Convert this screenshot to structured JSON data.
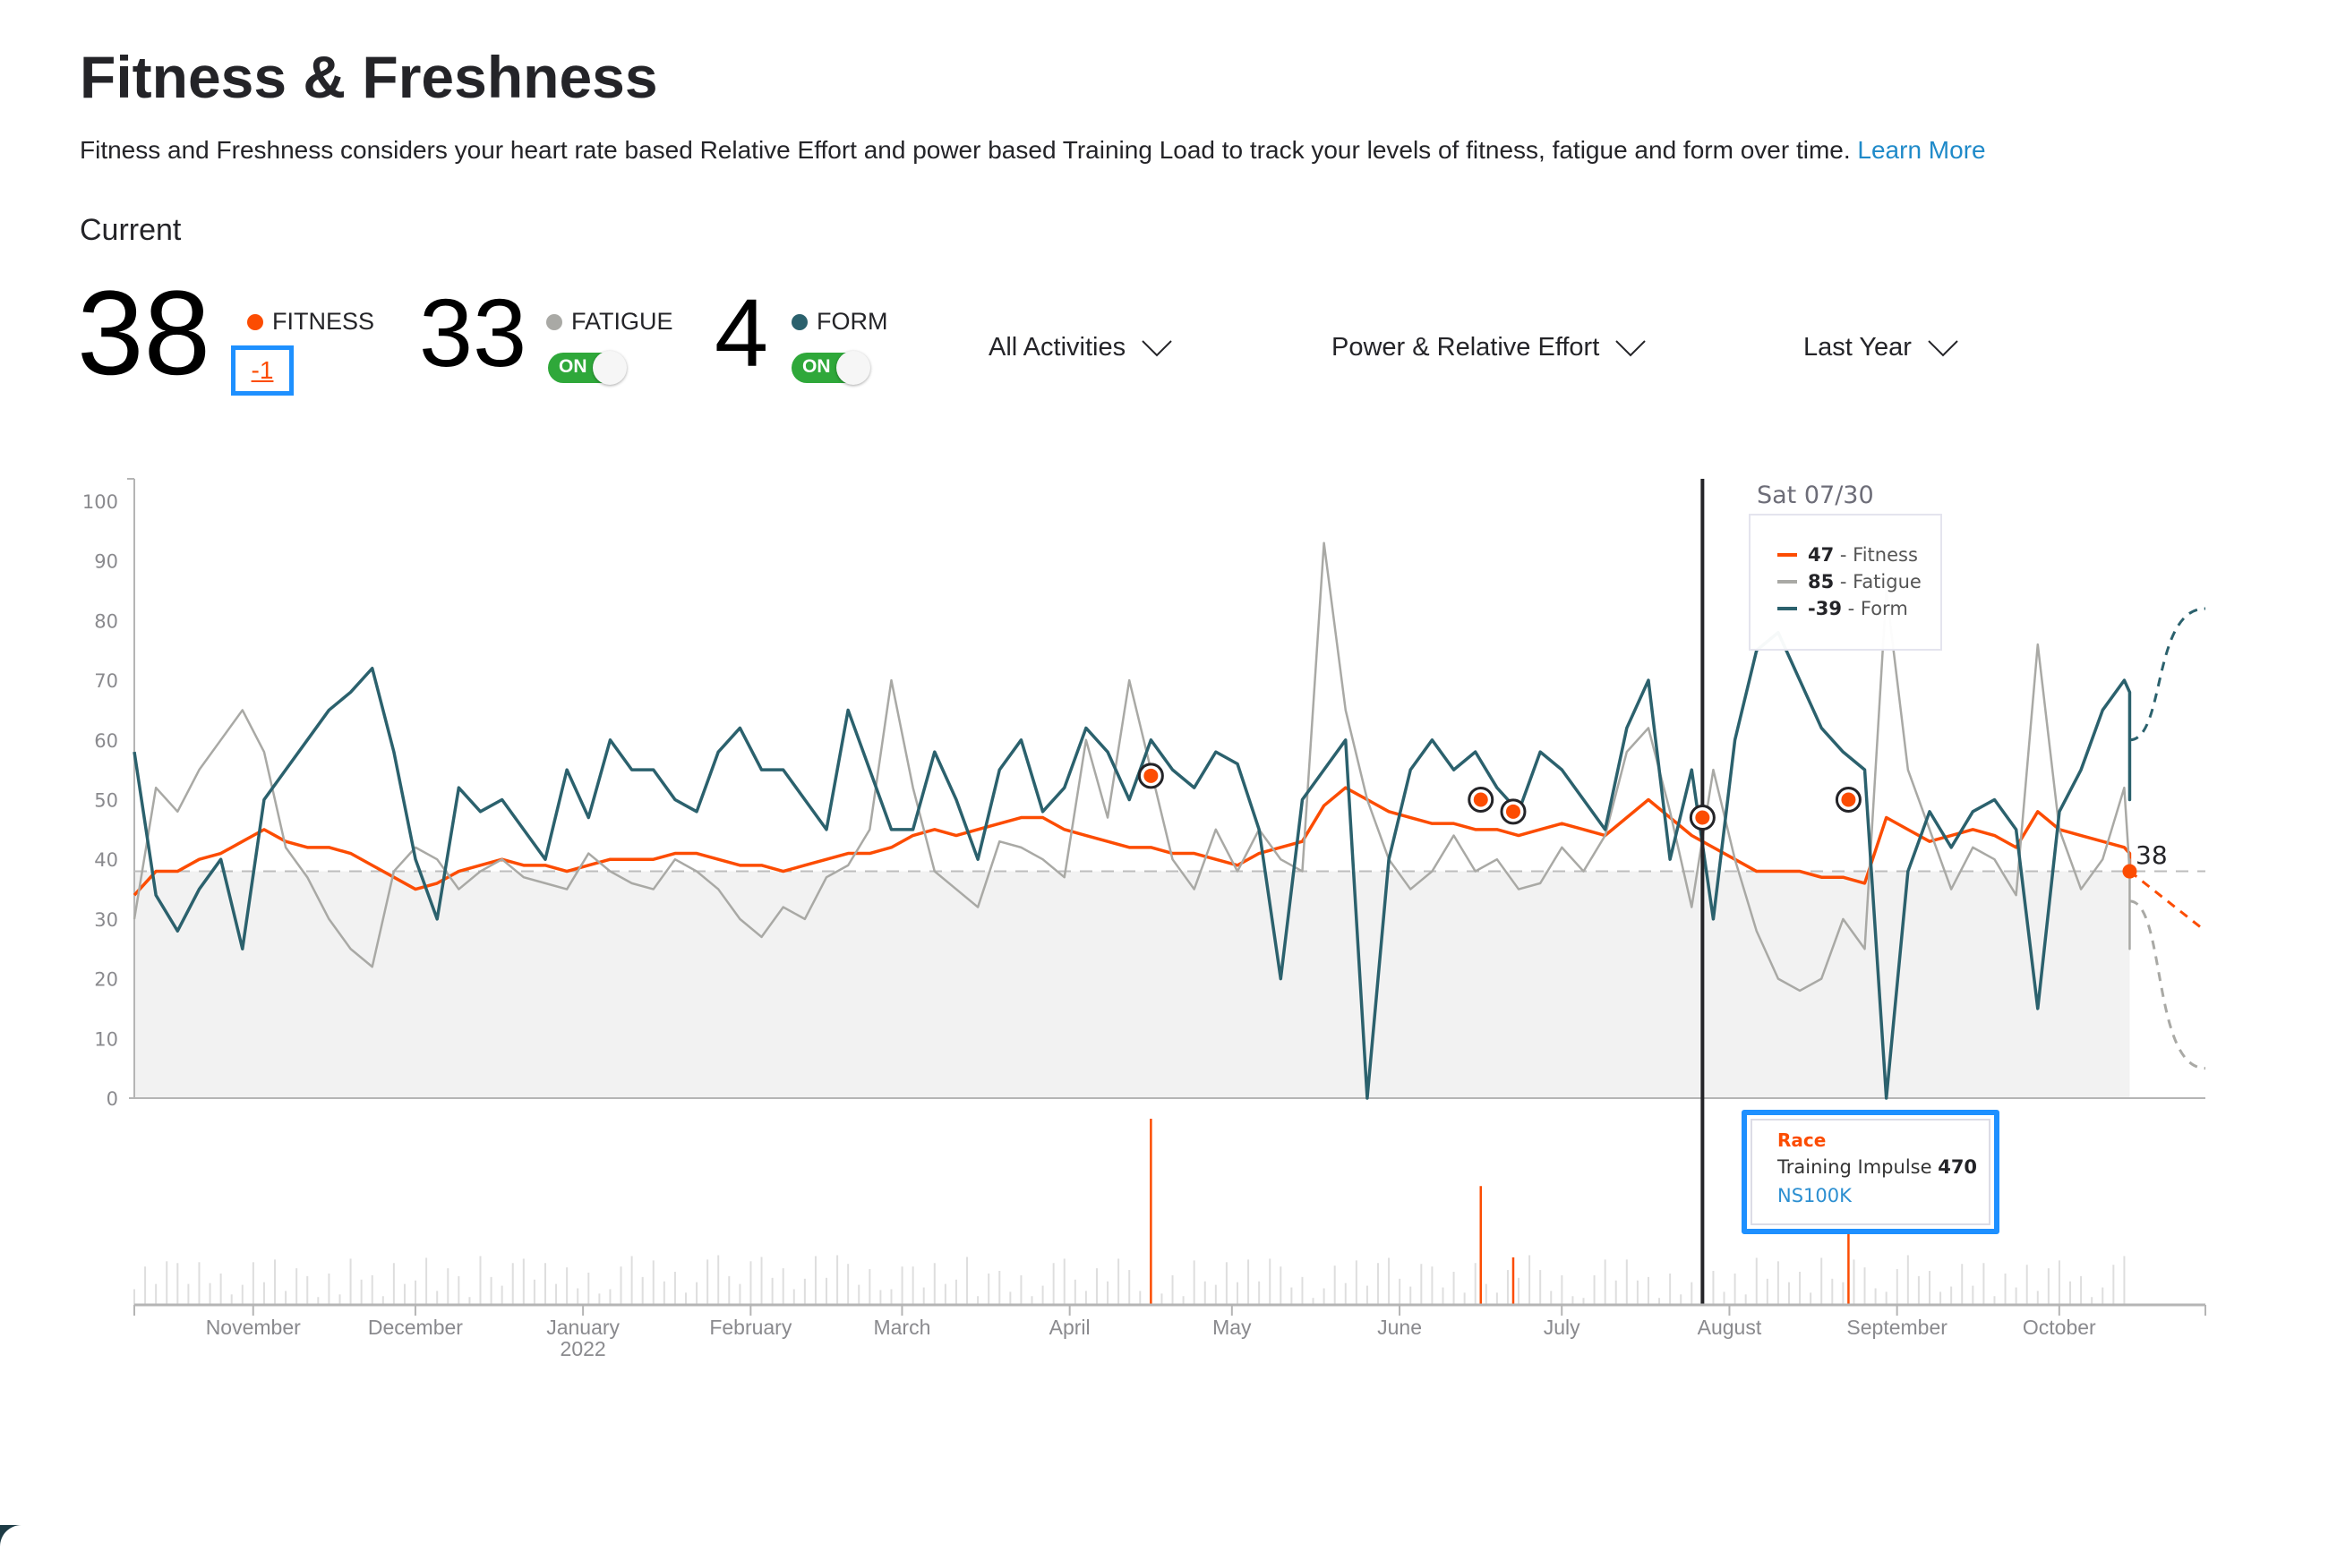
{
  "header": {
    "title": "Fitness & Freshness",
    "description": "Fitness and Freshness considers your heart rate based Relative Effort and power based Training Load to track your levels of fitness, fatigue and form over time.",
    "learn_more": "Learn More",
    "current_label": "Current"
  },
  "metrics": {
    "fitness": {
      "value": "38",
      "label": "FITNESS",
      "delta": "-1",
      "color": "#fc4c02"
    },
    "fatigue": {
      "value": "33",
      "label": "FATIGUE",
      "toggle": "ON",
      "toggle_on": true,
      "color": "#a9a9a5"
    },
    "form": {
      "value": "4",
      "label": "FORM",
      "toggle": "ON",
      "toggle_on": true,
      "color": "#2b616d"
    }
  },
  "filters": {
    "activities": "All Activities",
    "metric_type": "Power & Relative Effort",
    "range": "Last Year"
  },
  "tooltip": {
    "date": "Sat 07/30",
    "rows": [
      {
        "value": "47",
        "label": " - Fitness",
        "color": "#fc4c02"
      },
      {
        "value": "85",
        "label": " - Fatigue",
        "color": "#a9a9a5"
      },
      {
        "value": "-39",
        "label": " - Form",
        "color": "#2b616d"
      }
    ]
  },
  "race_tooltip": {
    "type": "Race",
    "metric_label": "Training Impulse ",
    "metric_value": "470",
    "activity_name": "NS100K"
  },
  "end_label": "38",
  "chart_data": {
    "type": "line",
    "title": "Fitness & Freshness",
    "xlabel": "",
    "ylabel": "",
    "ylim": [
      0,
      100
    ],
    "yticks": [
      0,
      10,
      20,
      30,
      40,
      50,
      60,
      70,
      80,
      90,
      100
    ],
    "x_start": "2021-10-13",
    "x_end": "2022-10-31",
    "today": "2022-10-17",
    "month_ticks": [
      {
        "date": "2021-11-01",
        "label": "November",
        "sub": ""
      },
      {
        "date": "2021-12-01",
        "label": "December",
        "sub": ""
      },
      {
        "date": "2022-01-01",
        "label": "January",
        "sub": "2022"
      },
      {
        "date": "2022-02-01",
        "label": "February",
        "sub": ""
      },
      {
        "date": "2022-03-01",
        "label": "March",
        "sub": ""
      },
      {
        "date": "2022-04-01",
        "label": "April",
        "sub": ""
      },
      {
        "date": "2022-05-01",
        "label": "May",
        "sub": ""
      },
      {
        "date": "2022-06-01",
        "label": "June",
        "sub": ""
      },
      {
        "date": "2022-07-01",
        "label": "July",
        "sub": ""
      },
      {
        "date": "2022-08-01",
        "label": "August",
        "sub": ""
      },
      {
        "date": "2022-09-01",
        "label": "September",
        "sub": ""
      },
      {
        "date": "2022-10-01",
        "label": "October",
        "sub": ""
      }
    ],
    "reference_line": 38,
    "step_days": 4,
    "series": [
      {
        "name": "Fitness",
        "color": "#fc4c02",
        "values": [
          34,
          38,
          38,
          40,
          41,
          43,
          45,
          43,
          42,
          42,
          41,
          39,
          37,
          35,
          36,
          38,
          39,
          40,
          39,
          39,
          38,
          39,
          40,
          40,
          40,
          41,
          41,
          40,
          39,
          39,
          38,
          39,
          40,
          41,
          41,
          42,
          44,
          45,
          44,
          45,
          46,
          47,
          47,
          45,
          44,
          43,
          42,
          42,
          41,
          41,
          40,
          39,
          41,
          42,
          43,
          49,
          52,
          50,
          48,
          47,
          46,
          46,
          45,
          45,
          44,
          45,
          46,
          45,
          44,
          47,
          50,
          47,
          44,
          42,
          40,
          38,
          38,
          38,
          37,
          37,
          36,
          47,
          45,
          43,
          44,
          45,
          44,
          42,
          48,
          45,
          44,
          43,
          42,
          41,
          40,
          40,
          39,
          39,
          39,
          39,
          38
        ]
      },
      {
        "name": "Fatigue",
        "color": "#a9a9a5",
        "values": [
          30,
          52,
          48,
          55,
          60,
          65,
          58,
          42,
          37,
          30,
          25,
          22,
          38,
          42,
          40,
          35,
          38,
          40,
          37,
          36,
          35,
          41,
          38,
          36,
          35,
          40,
          38,
          35,
          30,
          27,
          32,
          30,
          37,
          39,
          45,
          70,
          52,
          38,
          35,
          32,
          43,
          42,
          40,
          37,
          60,
          47,
          70,
          55,
          40,
          35,
          45,
          38,
          45,
          40,
          38,
          93,
          65,
          50,
          40,
          35,
          38,
          44,
          38,
          40,
          35,
          36,
          42,
          38,
          44,
          58,
          62,
          48,
          32,
          55,
          40,
          28,
          20,
          18,
          20,
          30,
          25,
          85,
          55,
          45,
          35,
          42,
          40,
          34,
          76,
          45,
          35,
          40,
          52,
          38,
          35,
          30,
          25,
          30,
          35,
          40,
          33
        ]
      },
      {
        "name": "Form",
        "color": "#2b616d",
        "values": [
          58,
          34,
          28,
          35,
          40,
          25,
          50,
          55,
          60,
          65,
          68,
          72,
          58,
          40,
          30,
          52,
          48,
          50,
          45,
          40,
          55,
          47,
          60,
          55,
          55,
          50,
          48,
          58,
          62,
          55,
          55,
          50,
          45,
          65,
          55,
          45,
          45,
          58,
          50,
          40,
          55,
          60,
          48,
          52,
          62,
          58,
          50,
          60,
          55,
          52,
          58,
          56,
          45,
          20,
          50,
          55,
          60,
          0,
          40,
          55,
          60,
          55,
          58,
          52,
          48,
          58,
          55,
          50,
          45,
          62,
          70,
          40,
          55,
          30,
          60,
          75,
          78,
          70,
          62,
          58,
          55,
          0,
          38,
          48,
          42,
          48,
          50,
          45,
          15,
          48,
          55,
          65,
          70,
          68,
          58,
          55,
          50,
          55,
          52,
          58,
          60
        ]
      }
    ],
    "projections": [
      {
        "name": "Fitness projection",
        "values_end": 28
      },
      {
        "name": "Fatigue projection",
        "values_end": 5
      },
      {
        "name": "Form projection",
        "values_end": 82
      }
    ],
    "race_markers": [
      {
        "date": "2022-04-19",
        "fitness": 54
      },
      {
        "date": "2022-06-19",
        "fitness": 50
      },
      {
        "date": "2022-06-25",
        "fitness": 48
      },
      {
        "date": "2022-07-30",
        "fitness": 47
      },
      {
        "date": "2022-08-26",
        "fitness": 50
      }
    ],
    "selected_date": "2022-07-30",
    "impulse_bars": {
      "race_values": [
        {
          "date": "2022-04-19",
          "value": 470
        },
        {
          "date": "2022-06-19",
          "value": 300
        },
        {
          "date": "2022-06-25",
          "value": 120
        },
        {
          "date": "2022-07-30",
          "value": 470
        },
        {
          "date": "2022-08-26",
          "value": 240
        }
      ],
      "max": 470
    }
  }
}
